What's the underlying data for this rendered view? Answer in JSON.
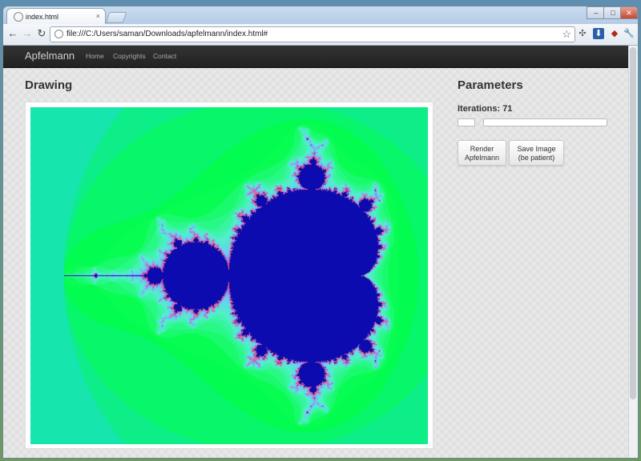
{
  "browser": {
    "tab_title": "index.html",
    "tab_close": "×",
    "url": "file:///C:/Users/saman/Downloads/apfelmann/index.html#",
    "window_controls": {
      "minimize": "–",
      "maximize": "□",
      "close": "✕"
    },
    "nav": {
      "back": "←",
      "forward": "→",
      "reload": "↻",
      "star": "☆"
    },
    "extensions": [
      "puzzle-icon",
      "download-icon",
      "red-bird-icon",
      "wrench-icon"
    ]
  },
  "navbar": {
    "brand": "Apfelmann",
    "links": [
      "Home",
      "Copyrights",
      "Contact"
    ]
  },
  "drawing": {
    "title": "Drawing"
  },
  "parameters": {
    "title": "Parameters",
    "iterations_label": "Iterations:",
    "iterations_value": "71",
    "iterations_fraction": 0.0,
    "render_button": [
      "Render",
      "Apfelmann"
    ],
    "save_button": [
      "Save Image",
      "(be patient)"
    ]
  },
  "colors": {
    "navbar": "#222222",
    "set_interior": "#0b0bb0",
    "outer_cyan": "#3cd6e8",
    "green": "#00ff44"
  }
}
